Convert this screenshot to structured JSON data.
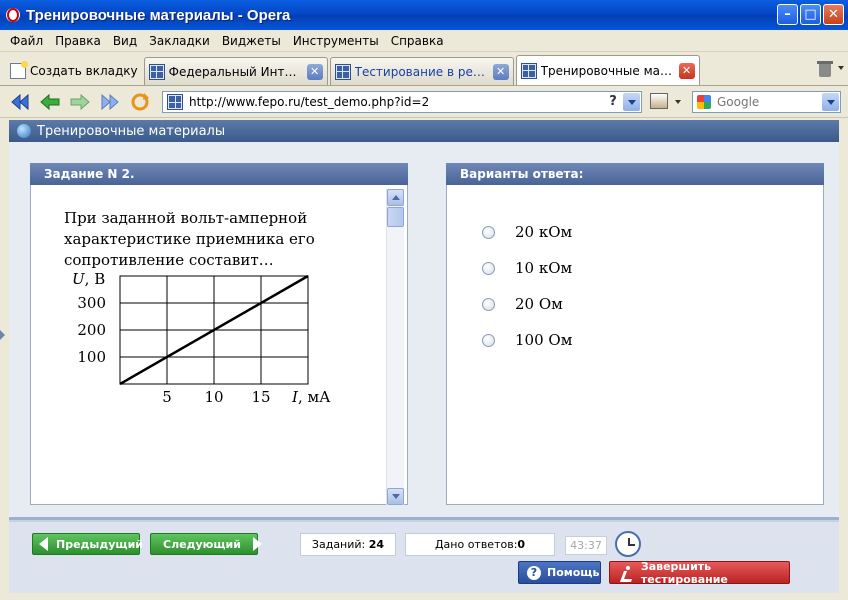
{
  "window": {
    "title": "Тренировочные материалы - Opera"
  },
  "menu": [
    "Файл",
    "Правка",
    "Вид",
    "Закладки",
    "Виджеты",
    "Инструменты",
    "Справка"
  ],
  "tabs": {
    "new_tab": "Создать вкладку",
    "items": [
      {
        "label": "Федеральный Интерн...",
        "state": "inactive"
      },
      {
        "label": "Тестирование в реж...",
        "state": "inactive"
      },
      {
        "label": "Тренировочные мате...",
        "state": "active"
      }
    ]
  },
  "address": {
    "url": "http://www.fepo.ru/test_demo.php?id=2",
    "help": "?"
  },
  "search": {
    "placeholder": "Google"
  },
  "page": {
    "header": "Тренировочные материалы",
    "task_title": "Задание N 2.",
    "answers_title": "Варианты ответа:",
    "question_line1": "При заданной вольт-амперной",
    "question_line2": "характеристике приемника его",
    "question_line3": "сопротивление составит…",
    "options": [
      "20 кОм",
      "10 кОм",
      "20 Ом",
      "100 Ом"
    ]
  },
  "chart_data": {
    "type": "line",
    "ylabel_var": "U",
    "ylabel_unit": ", В",
    "xlabel_var": "I",
    "xlabel_unit": ", мА",
    "x_ticks": [
      "5",
      "10",
      "15"
    ],
    "y_ticks": [
      "100",
      "200",
      "300"
    ],
    "xlim": [
      0,
      20
    ],
    "ylim": [
      0,
      400
    ],
    "grid": true,
    "series": [
      {
        "x": [
          0,
          20
        ],
        "y": [
          0,
          400
        ]
      }
    ]
  },
  "footer": {
    "prev": "Предыдущий",
    "next": "Следующий",
    "tasks_label": "Заданий:",
    "tasks_count": "24",
    "answered_label": "Дано ответов:",
    "answered_count": "0",
    "timer": "43:37",
    "help": "Помощь",
    "finish": "Завершить тестирование"
  },
  "colors": {
    "accent": "#4a6497",
    "nav_green": "#2e8f2e",
    "finish_red": "#b82323"
  }
}
